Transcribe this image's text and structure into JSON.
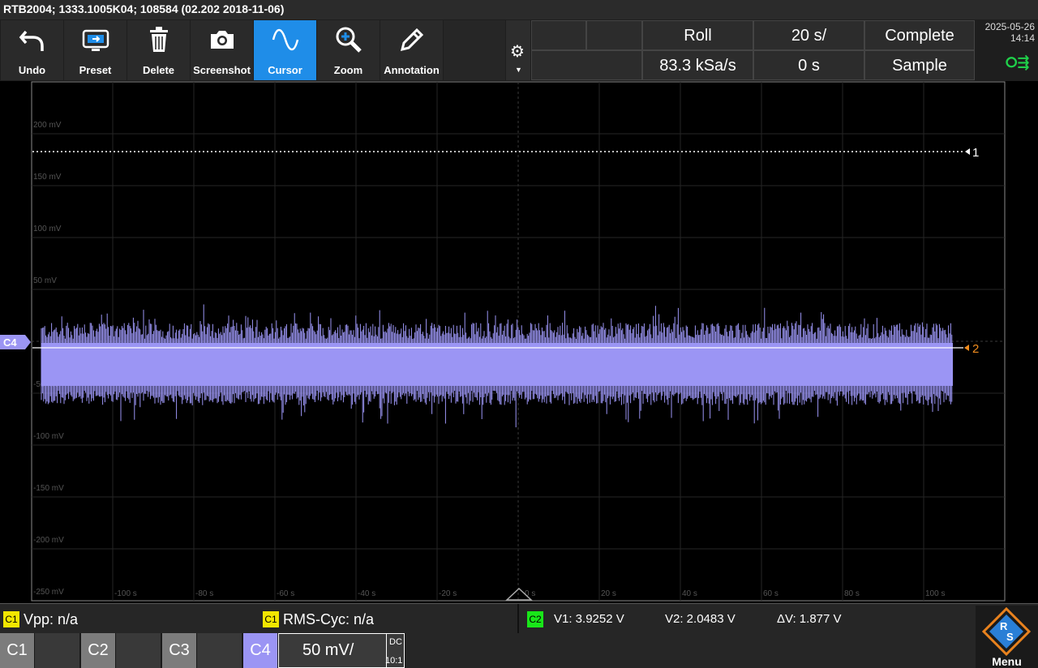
{
  "titlebar": {
    "text": "RTB2004; 1333.1005K04; 108584 (02.202 2018-11-06)"
  },
  "toolbar": {
    "tools": [
      {
        "label": "Undo",
        "icon": "undo-icon"
      },
      {
        "label": "Preset",
        "icon": "preset-icon"
      },
      {
        "label": "Delete",
        "icon": "trash-icon"
      },
      {
        "label": "Screenshot",
        "icon": "camera-icon"
      },
      {
        "label": "Cursor",
        "icon": "cursor-wave-icon",
        "active": true
      },
      {
        "label": "Zoom",
        "icon": "zoom-icon"
      },
      {
        "label": "Annotation",
        "icon": "pencil-icon"
      }
    ],
    "settings_icon": "gear-icon"
  },
  "acquisition": {
    "mode": "Roll",
    "time_scale": "20 s/",
    "status": "Complete",
    "sample_rate": "83.3 kSa/s",
    "time_offset": "0 s",
    "acq_type": "Sample"
  },
  "datetime": {
    "date": "2025-05-26",
    "time": "14:14"
  },
  "usb_icon": "usb-icon",
  "grid": {
    "y_labels": [
      "200 mV",
      "150 mV",
      "100 mV",
      "50 mV",
      "-50 mV",
      "-100 mV",
      "-150 mV",
      "-200 mV",
      "-250 mV"
    ],
    "x_labels": [
      "-100 s",
      "-80 s",
      "-60 s",
      "-40 s",
      "-20 s",
      "0 s",
      "20 s",
      "40 s",
      "60 s",
      "80 s",
      "100 s"
    ]
  },
  "markers": {
    "channel_marker": "C4",
    "cursor1": "1",
    "cursor2": "2"
  },
  "colors": {
    "waveform": "#9b95f4",
    "cursor2": "#f08c1e",
    "active_tool": "#1f8de8",
    "c1_badge": "#f2e600",
    "c2_badge": "#19e619",
    "usb": "#1fd14a"
  },
  "measurements": {
    "m1_channel": "C1",
    "m1_text": "Vpp: n/a",
    "m2_channel": "C1",
    "m2_text": "RMS-Cyc: n/a",
    "cursor_channel": "C2",
    "v1": "V1: 3.9252 V",
    "v2": "V2: 2.0483 V",
    "dv": "ΔV: 1.877 V"
  },
  "channels": {
    "c1": "C1",
    "c2": "C2",
    "c3": "C3",
    "c4": "C4",
    "c4_scale": "50 mV/",
    "c4_coupling": "DC",
    "c4_probe": "10:1"
  },
  "menu": {
    "label": "Menu"
  }
}
